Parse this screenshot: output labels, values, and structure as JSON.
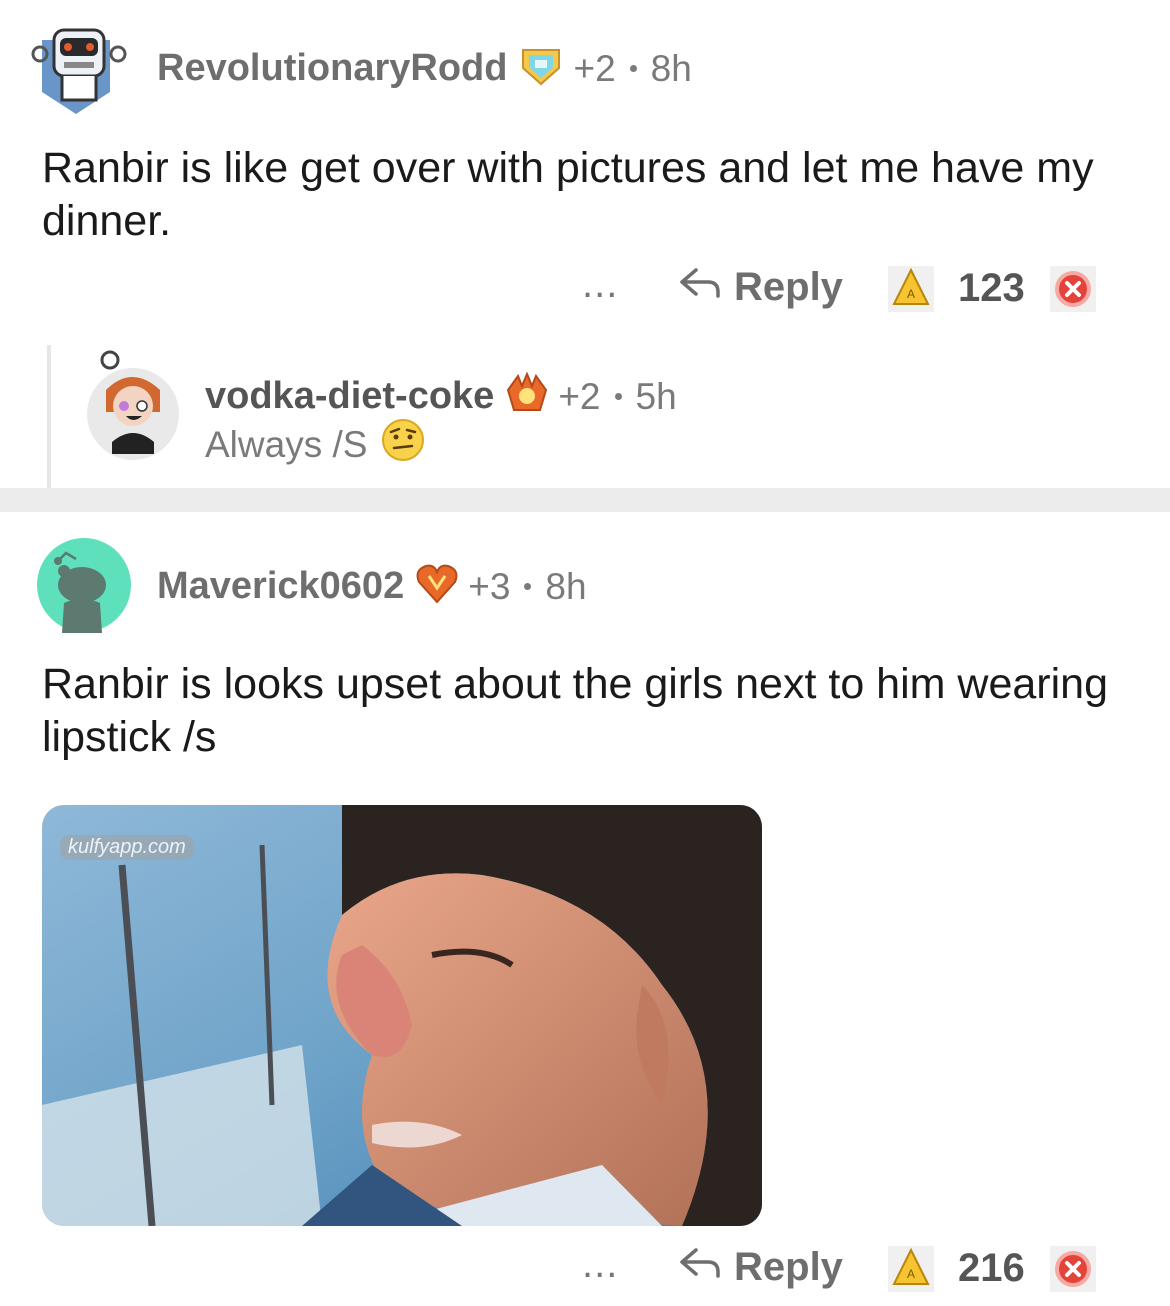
{
  "comments": [
    {
      "username": "RevolutionaryRodd",
      "awards": "+2",
      "time": "8h",
      "text": "Ranbir is like get over with pictures and let me have my dinner.",
      "more": "...",
      "reply_label": "Reply",
      "score": "123"
    },
    {
      "username": "Maverick0602",
      "awards": "+3",
      "time": "8h",
      "text": "Ranbir is looks upset about the girls next to him wearing lipstick /s",
      "more": "...",
      "reply_label": "Reply",
      "score": "216",
      "image_watermark": "kulfyapp.com"
    }
  ],
  "reply": {
    "username": "vodka-diet-coke",
    "awards": "+2",
    "time": "5h",
    "text": "Always /S"
  },
  "colors": {
    "divider": "#ececec",
    "upvote": "#f5c430",
    "downvote": "#e4433a",
    "avatar_teal": "#5fe0bd"
  }
}
